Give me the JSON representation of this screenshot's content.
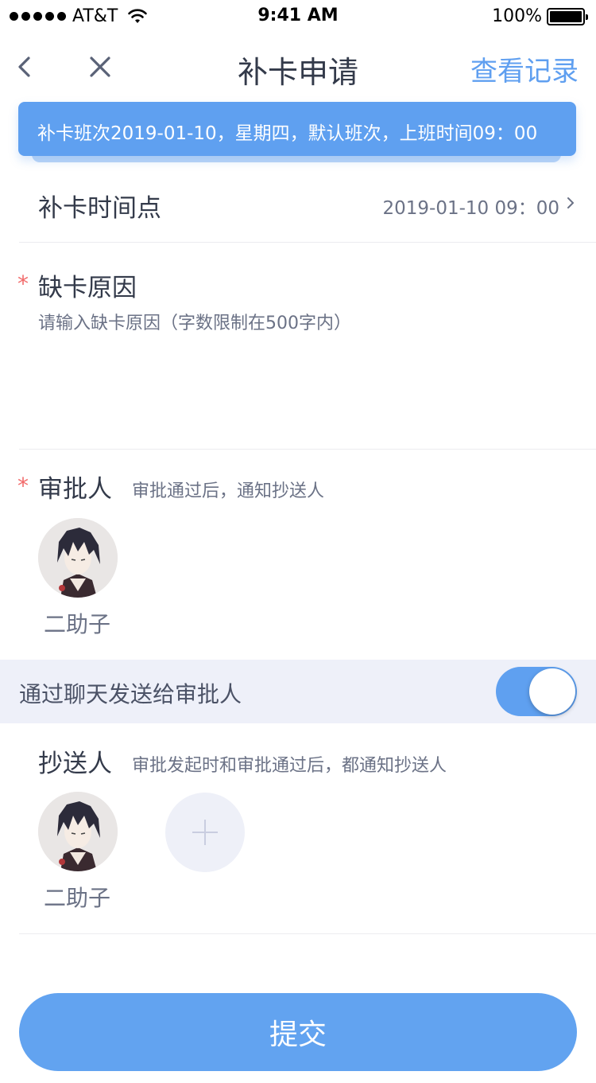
{
  "status_bar": {
    "carrier": "AT&T",
    "time": "9:41 AM",
    "battery": "100%",
    "battery_level": 1.0
  },
  "nav": {
    "title": "补卡申请",
    "action": "查看记录"
  },
  "banner": {
    "text": "补卡班次2019-01-10，星期四，默认班次，上班时间09：00"
  },
  "time_point": {
    "label": "补卡时间点",
    "value": "2019-01-10 09：00"
  },
  "reason": {
    "required_mark": "*",
    "label": "缺卡原因",
    "placeholder": "请输入缺卡原因（字数限制在500字内）",
    "value": ""
  },
  "approver": {
    "required_mark": "*",
    "label": "审批人",
    "subtitle": "审批通过后，通知抄送人",
    "people": [
      {
        "name": "二助子"
      }
    ]
  },
  "chat_toggle": {
    "label": "通过聊天发送给审批人",
    "on": true
  },
  "cc": {
    "label": "抄送人",
    "subtitle": "审批发起时和审批通过后，都通知抄送人",
    "people": [
      {
        "name": "二助子"
      }
    ]
  },
  "submit": {
    "label": "提交"
  },
  "colors": {
    "accent": "#5fa0f0",
    "required": "#f26b6b",
    "text": "#333a4a",
    "secondary": "#6b7286"
  }
}
